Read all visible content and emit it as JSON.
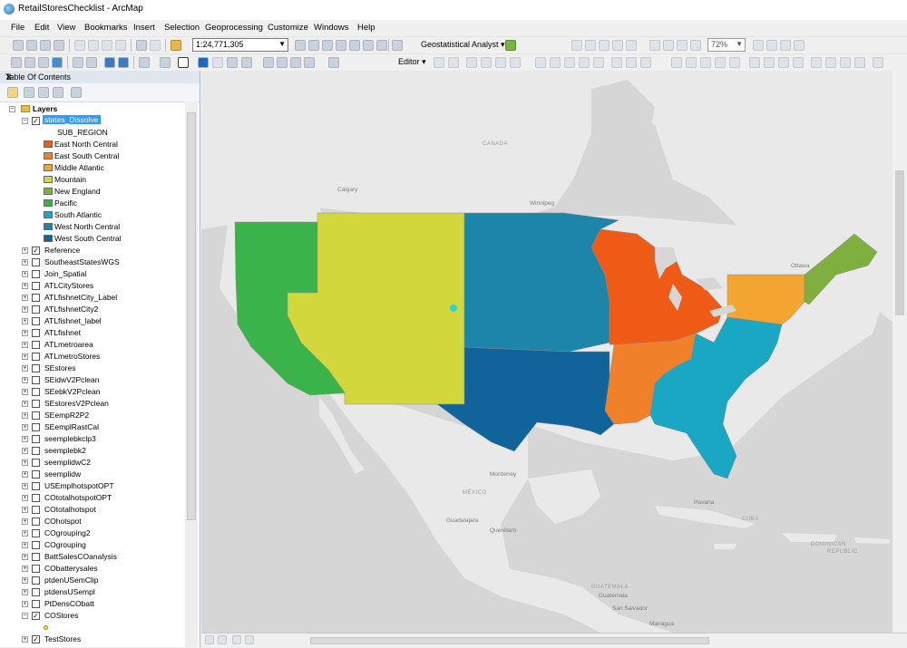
{
  "window": {
    "title": "RetailStoresChecklist - ArcMap"
  },
  "menu": [
    "File",
    "Edit",
    "View",
    "Bookmarks",
    "Insert",
    "Selection",
    "Geoprocessing",
    "Customize",
    "Windows",
    "Help"
  ],
  "toolbar": {
    "scale": "1:24,771,305",
    "geostat_label": "Geostatistical Analyst",
    "editor_label": "Editor",
    "zoom_value": "72%"
  },
  "toc": {
    "title": "Table Of Contents",
    "group": "Layers",
    "selected_layer": "states_Dissolve",
    "legend_field": "SUB_REGION",
    "legend": [
      {
        "label": "East North Central",
        "color": "#ef5a17"
      },
      {
        "label": "East South Central",
        "color": "#f0812a"
      },
      {
        "label": "Middle Atlantic",
        "color": "#f4a531"
      },
      {
        "label": "Mountain",
        "color": "#d2d73c"
      },
      {
        "label": "New England",
        "color": "#7faf3f"
      },
      {
        "label": "Pacific",
        "color": "#3ab44a"
      },
      {
        "label": "South Atlantic",
        "color": "#19a7c3"
      },
      {
        "label": "West North Central",
        "color": "#1d84aa"
      },
      {
        "label": "West South Central",
        "color": "#11639b"
      }
    ],
    "layers": [
      {
        "name": "Reference",
        "checked": true
      },
      {
        "name": "SoutheastStatesWGS",
        "checked": false
      },
      {
        "name": "Join_Spatial",
        "checked": false
      },
      {
        "name": "ATLCityStores",
        "checked": false
      },
      {
        "name": "ATLfishnetCity_Label",
        "checked": false
      },
      {
        "name": "ATLfishnetCity2",
        "checked": false
      },
      {
        "name": "ATLfishnet_label",
        "checked": false
      },
      {
        "name": "ATLfishnet",
        "checked": false
      },
      {
        "name": "ATLmetroarea",
        "checked": false
      },
      {
        "name": "ATLmetroStores",
        "checked": false
      },
      {
        "name": "SEstores",
        "checked": false
      },
      {
        "name": "SEidwV2Pclean",
        "checked": false
      },
      {
        "name": "SEebkV2Pclean",
        "checked": false
      },
      {
        "name": "SEstoresV2Pclean",
        "checked": false
      },
      {
        "name": "SEempR2P2",
        "checked": false
      },
      {
        "name": "SEemplRastCal",
        "checked": false
      },
      {
        "name": "seemplebkclp3",
        "checked": false
      },
      {
        "name": "seemplebk2",
        "checked": false
      },
      {
        "name": "seemplidwC2",
        "checked": false
      },
      {
        "name": "seemplidw",
        "checked": false
      },
      {
        "name": "USEmplhotspotOPT",
        "checked": false
      },
      {
        "name": "COtotalhotspotOPT",
        "checked": false
      },
      {
        "name": "COtotalhotspot",
        "checked": false
      },
      {
        "name": "COhotspot",
        "checked": false
      },
      {
        "name": "COgrouping2",
        "checked": false
      },
      {
        "name": "COgrouping",
        "checked": false
      },
      {
        "name": "BattSalesCOanalysis",
        "checked": false
      },
      {
        "name": "CObatterysales",
        "checked": false
      },
      {
        "name": "ptdenUSemClip",
        "checked": false
      },
      {
        "name": "ptdensUSempl",
        "checked": false
      },
      {
        "name": "PtDensCObatt",
        "checked": false
      },
      {
        "name": "COStores",
        "checked": true
      },
      {
        "name": "TestStores",
        "checked": true
      }
    ]
  },
  "map": {
    "labels": {
      "canada": "CANADA",
      "calgary": "Calgary",
      "winnipeg": "Winnipeg",
      "mexico": "MÉXICO",
      "monterrey": "Monterrey",
      "guadalajara": "Guadalajara",
      "queretaro": "Querétaro",
      "havana": "Havana",
      "cuba": "CUBA",
      "guatemala_region": "GUATEMALA",
      "guatemala_city": "Guatemala",
      "san_salvador": "San Salvador",
      "managua": "Managua",
      "dominican": "DOMINICAN",
      "republic": "REPUBLIC",
      "ottawa": "Ottawa"
    }
  }
}
